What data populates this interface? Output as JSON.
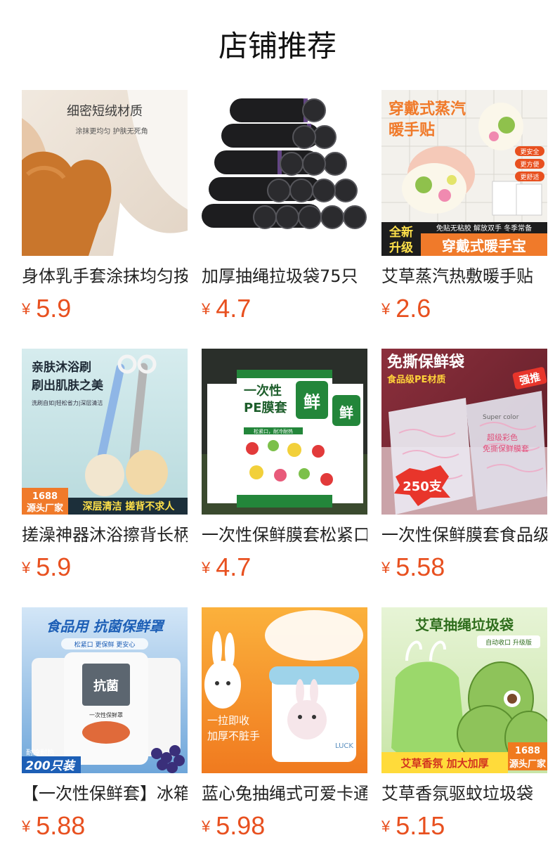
{
  "header": {
    "title": "店铺推荐"
  },
  "products": [
    {
      "name": "身体乳手套涂抹均匀按摩手套",
      "currency": "¥",
      "price": "5.9",
      "image_text": [
        "细密短绒材质",
        "涂抹更均匀 护肤无死角"
      ]
    },
    {
      "name": "加厚抽绳拉圾袋75只",
      "currency": "¥",
      "price": "4.7",
      "image_text": []
    },
    {
      "name": "艾草蒸汽热敷暖手贴",
      "currency": "¥",
      "price": "2.6",
      "image_text": [
        "穿戴式蒸汽",
        "暖手贴",
        "更安全",
        "更方便",
        "更舒适",
        "全新",
        "升级",
        "免贴无粘胶 解放双手 冬季常备",
        "穿戴式暖手宝"
      ]
    },
    {
      "name": "搓澡神器沐浴擦背长柄刷",
      "currency": "¥",
      "price": "5.9",
      "image_text": [
        "亲肤沐浴刷",
        "刷出肌肤之美",
        "洗刷自如|轻松省力|深层清洁",
        "1688",
        "源头厂家",
        "深层清洁 搓背不求人"
      ]
    },
    {
      "name": "一次性保鲜膜套松紧口",
      "currency": "¥",
      "price": "4.7",
      "image_text": [
        "一次性",
        "PE膜套",
        "鲜",
        "松紧口，耐冷耐热"
      ]
    },
    {
      "name": "一次性保鲜膜套食品级",
      "currency": "¥",
      "price": "5.58",
      "image_text": [
        "免撕保鲜袋",
        "食品级PE材质",
        "强推",
        "250支",
        "Super color",
        "超级彩色",
        "免撕保鲜膜套"
      ]
    },
    {
      "name": "【一次性保鲜套】冰箱用",
      "currency": "¥",
      "price": "5.88",
      "image_text": [
        "食品用 抗菌保鲜罩",
        "松紧口 更保鲜 更安心",
        "抗菌",
        "一次性保鲜罩",
        "耐冷耐热",
        "200只装"
      ]
    },
    {
      "name": "蓝心兔抽绳式可爱卡通垃圾袋",
      "currency": "¥",
      "price": "5.98",
      "image_text": [
        "LUCK",
        "一拉即收",
        "加厚不脏手"
      ]
    },
    {
      "name": "艾草香氛驱蚊垃圾袋",
      "currency": "¥",
      "price": "5.15",
      "image_text": [
        "艾草抽绳垃圾袋",
        "自动收口 升级版",
        "1688",
        "源头厂家",
        "艾草香氛 加大加厚"
      ]
    }
  ],
  "colors": {
    "price": "#e8501f",
    "title": "#111111",
    "name": "#222222"
  }
}
